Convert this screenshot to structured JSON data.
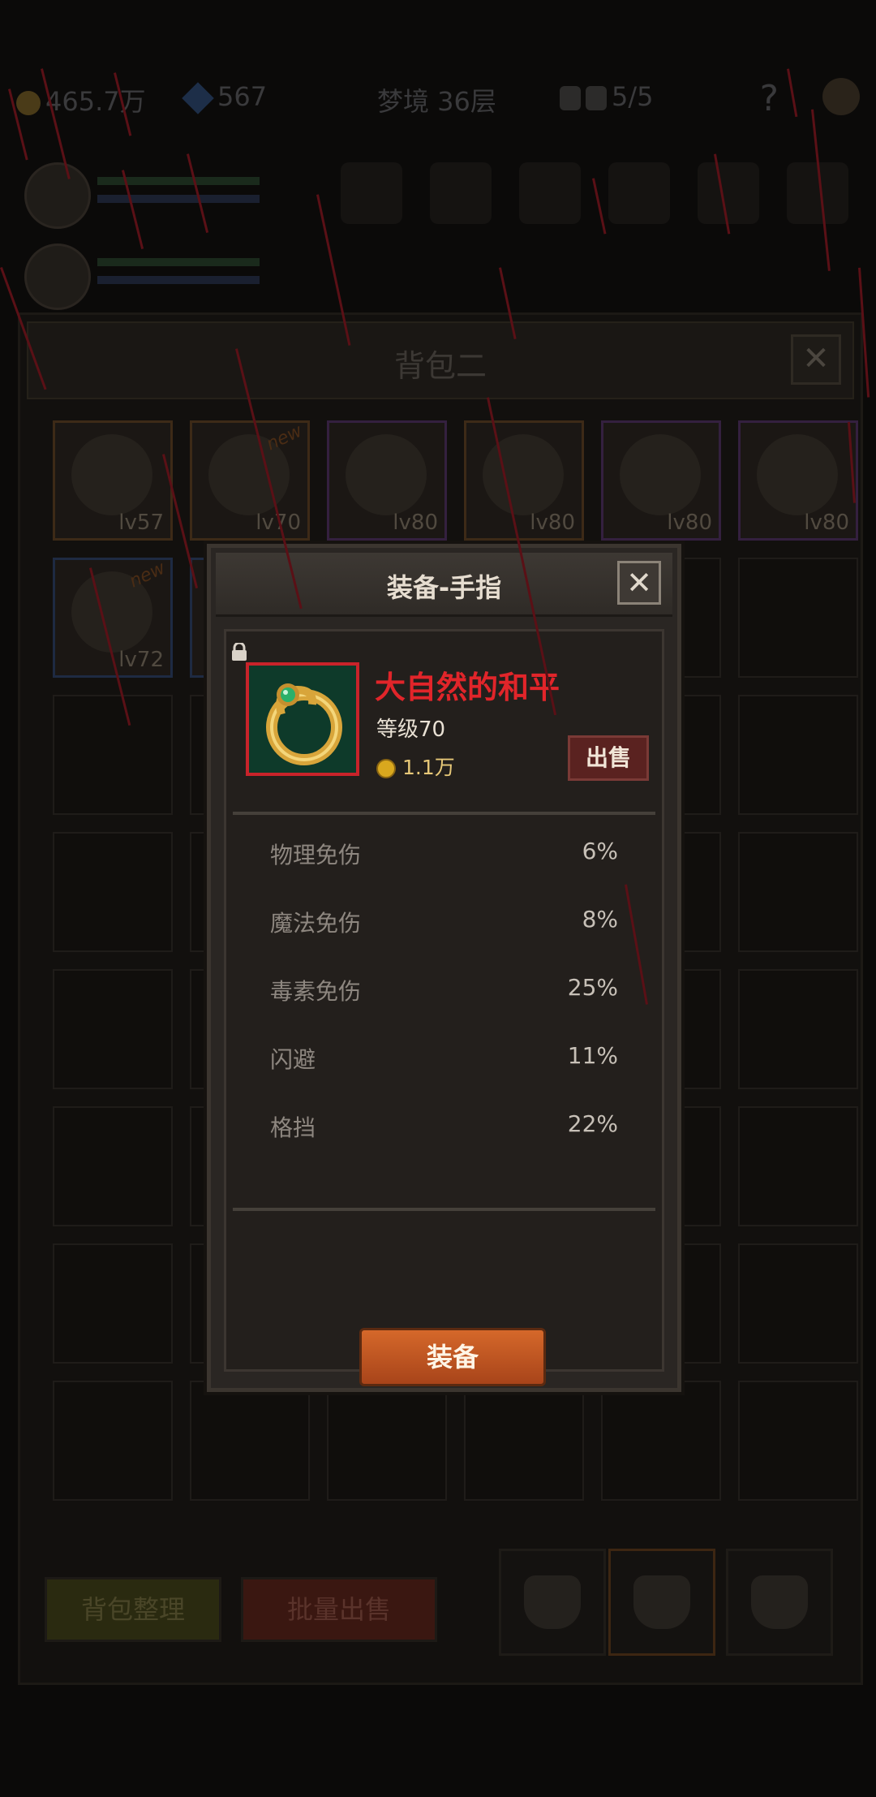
{
  "hud": {
    "gold": "465.7万",
    "gems": "567",
    "floor": "梦境 36层",
    "keys_label": "5/5",
    "help": "?"
  },
  "bag": {
    "title": "背包二",
    "close": "✕",
    "items": [
      {
        "level": "lv57",
        "rarity": "orange",
        "icon": "chest-armor-icon"
      },
      {
        "level": "lv70",
        "rarity": "orange",
        "icon": "ring-icon",
        "new": "new"
      },
      {
        "level": "lv80",
        "rarity": "purple",
        "icon": "orb-icon"
      },
      {
        "level": "lv80",
        "rarity": "orange",
        "icon": "armor-icon"
      },
      {
        "level": "lv80",
        "rarity": "purple",
        "icon": "helmet-icon"
      },
      {
        "level": "lv80",
        "rarity": "purple",
        "icon": "amulet-icon"
      },
      {
        "level": "lv72",
        "rarity": "blue",
        "icon": "bracer-icon",
        "new": "new"
      }
    ],
    "tidy_button": "背包整理",
    "bulk_sell_button": "批量出售"
  },
  "modal": {
    "title": "装备-手指",
    "close": "✕",
    "item_name": "大自然的和平",
    "item_level": "等级70",
    "item_price": "1.1万",
    "sell_button": "出售",
    "stats": [
      {
        "label": "物理免伤",
        "value": "6%"
      },
      {
        "label": "魔法免伤",
        "value": "8%"
      },
      {
        "label": "毒素免伤",
        "value": "25%"
      },
      {
        "label": "闪避",
        "value": "11%"
      },
      {
        "label": "格挡",
        "value": "22%"
      }
    ],
    "equip_button": "装备"
  },
  "colors": {
    "item_name": "#e1252a",
    "equip_button": "#c35a22",
    "frame_border": "#c8232a"
  }
}
